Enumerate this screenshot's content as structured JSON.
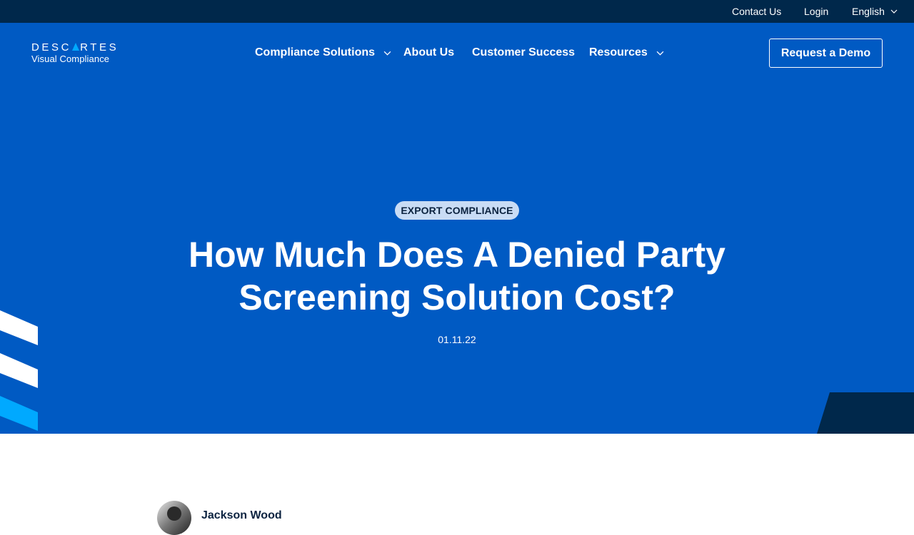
{
  "topbar": {
    "contact": "Contact Us",
    "login": "Login",
    "language": "English"
  },
  "logo": {
    "brand_part1": "DESC",
    "brand_part2": "RTES",
    "subtitle": "Visual Compliance"
  },
  "nav": {
    "items": [
      {
        "label": "Compliance Solutions",
        "has_dropdown": true
      },
      {
        "label": "About Us",
        "has_dropdown": false
      },
      {
        "label": "Customer Success",
        "has_dropdown": false
      },
      {
        "label": "Resources",
        "has_dropdown": true
      }
    ],
    "cta": "Request a Demo"
  },
  "hero": {
    "category": "EXPORT COMPLIANCE",
    "title": "How Much Does A Denied Party Screening Solution Cost?",
    "date": "01.11.22"
  },
  "author": {
    "name": "Jackson Wood"
  },
  "colors": {
    "topbar_bg": "#00284b",
    "hero_bg": "#005ac3",
    "accent": "#00a9ff",
    "tag_bg": "#c9dcf5",
    "dark_navy": "#0c2340"
  },
  "icons": {
    "dropdown": "chevron-down-icon",
    "logo_mark": "triangle-logo-mark"
  }
}
